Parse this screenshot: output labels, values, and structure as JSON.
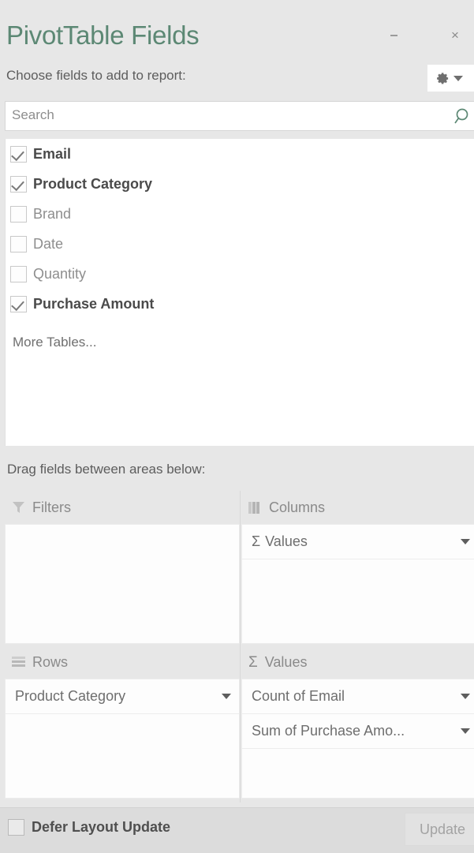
{
  "pane": {
    "title": "PivotTable Fields",
    "accent_color": "#5c8874",
    "background_color": "#e7e7e7"
  },
  "titlebar": {
    "minimize_label": "",
    "close_label": "×",
    "minimize_icon": "minimize-icon",
    "close_icon": "close-icon"
  },
  "choose": {
    "label": "Choose fields to add to report:",
    "tools_icon": "gear-icon",
    "tools_caret_icon": "chevron-down-icon"
  },
  "search": {
    "value": "",
    "placeholder": "Search",
    "icon": "search-icon"
  },
  "field_list": {
    "fields": [
      {
        "label": "Email",
        "checked": true
      },
      {
        "label": "Product Category",
        "checked": true
      },
      {
        "label": "Brand",
        "checked": false
      },
      {
        "label": "Date",
        "checked": false
      },
      {
        "label": "Quantity",
        "checked": false
      },
      {
        "label": "Purchase Amount",
        "checked": true
      }
    ],
    "more_tables_label": "More Tables..."
  },
  "areas": {
    "hint": "Drag fields between areas below:",
    "filters": {
      "label": "Filters",
      "icon": "funnel-icon",
      "items": []
    },
    "columns": {
      "label": "Columns",
      "icon": "columns-icon",
      "items": [
        {
          "label": "Values",
          "prefix": "Σ",
          "caret_icon": "chevron-down-icon"
        }
      ]
    },
    "rows": {
      "label": "Rows",
      "icon": "rows-icon",
      "items": [
        {
          "label": "Product Category",
          "prefix": "",
          "caret_icon": "chevron-down-icon"
        }
      ]
    },
    "values": {
      "label": "Values",
      "icon": "sigma-icon",
      "sigma": "Σ",
      "items": [
        {
          "label": "Count of Email",
          "prefix": "",
          "caret_icon": "chevron-down-icon"
        },
        {
          "label": "Sum of Purchase Amo...",
          "prefix": "",
          "caret_icon": "chevron-down-icon"
        }
      ]
    }
  },
  "footer": {
    "defer_label": "Defer Layout Update",
    "defer_checked": false,
    "update_label": "Update",
    "update_enabled": false
  }
}
